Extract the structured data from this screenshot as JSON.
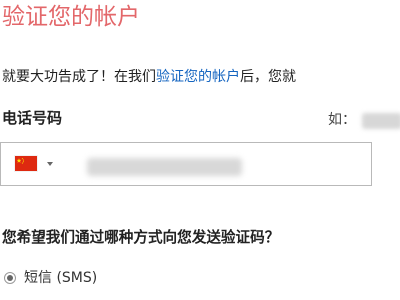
{
  "header": {
    "title": "验证您的帐户"
  },
  "intro": {
    "prefix": "就要大功告成了！在我们",
    "link_text": "验证您的帐户",
    "suffix": "后，您就"
  },
  "phone_section": {
    "label": "电话号码",
    "example_prefix": "如：",
    "country_icon": "china-flag-icon"
  },
  "verification": {
    "question": "您希望我们通过哪种方式向您发送验证码？",
    "options": [
      {
        "label": "短信 (SMS)",
        "selected": true
      }
    ]
  },
  "colors": {
    "title": "#e3676a",
    "link": "#1565c0",
    "border": "#b9b9b9"
  }
}
